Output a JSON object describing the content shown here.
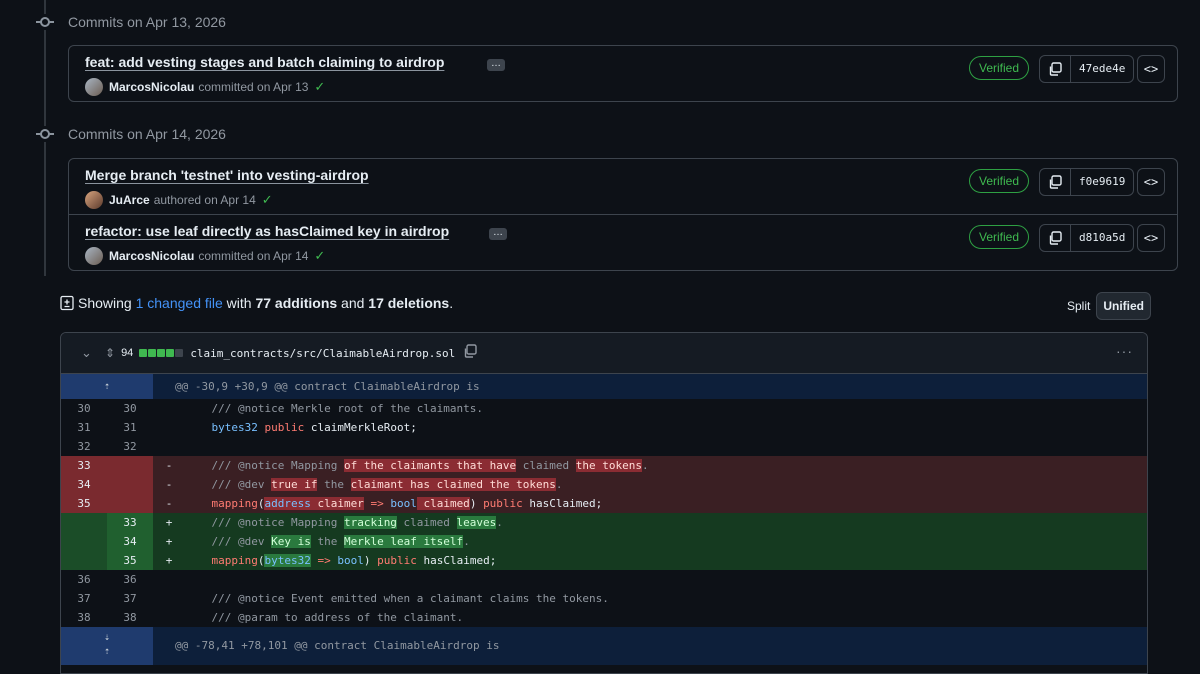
{
  "timeline": [
    {
      "date_label": "Commits on Apr 13, 2026",
      "commits": [
        {
          "title": "feat: add vesting stages and batch claiming to airdrop",
          "author": "MarcosNicolau",
          "action": "committed on Apr 13",
          "verified": "Verified",
          "hash": "47ede4e",
          "has_ellipsis": true
        }
      ]
    },
    {
      "date_label": "Commits on Apr 14, 2026",
      "commits": [
        {
          "title": "Merge branch 'testnet' into vesting-airdrop",
          "author": "JuArce",
          "action": "authored on Apr 14",
          "verified": "Verified",
          "hash": "f0e9619",
          "has_ellipsis": false
        },
        {
          "title": "refactor: use leaf directly as hasClaimed key in airdrop",
          "author": "MarcosNicolau",
          "action": "committed on Apr 14",
          "verified": "Verified",
          "hash": "d810a5d",
          "has_ellipsis": true
        }
      ]
    }
  ],
  "summary": {
    "prefix": "Showing",
    "changed_files": "1 changed file",
    "with": "with",
    "additions": "77 additions",
    "and": "and",
    "deletions": "17 deletions",
    "suffix": "."
  },
  "view_toggle": {
    "split": "Split",
    "unified": "Unified",
    "selected": "Unified"
  },
  "file": {
    "change_count": "94",
    "diffstat": [
      "add",
      "add",
      "add",
      "add",
      "neutral"
    ],
    "path": "claim_contracts/src/ClaimableAirdrop.sol",
    "hunk_header_1": "@@ -30,9 +30,9 @@ contract ClaimableAirdrop is",
    "hunk_header_2": "@@ -78,41 +78,101 @@ contract ClaimableAirdrop is"
  },
  "icons": {
    "collapse": "chevron-down-icon",
    "expand": "unfold-icon",
    "copy": "copy-icon",
    "browse": "code-icon",
    "more": "kebab-horizontal-icon",
    "check": "check-icon",
    "diff_file": "file-diff-icon"
  },
  "colors": {
    "verified": "#3fb950",
    "link": "#4493f8",
    "deletion_bg": "#3a1f23",
    "addition_bg": "#153a20",
    "hunk_bg": "#0d1f3a"
  }
}
